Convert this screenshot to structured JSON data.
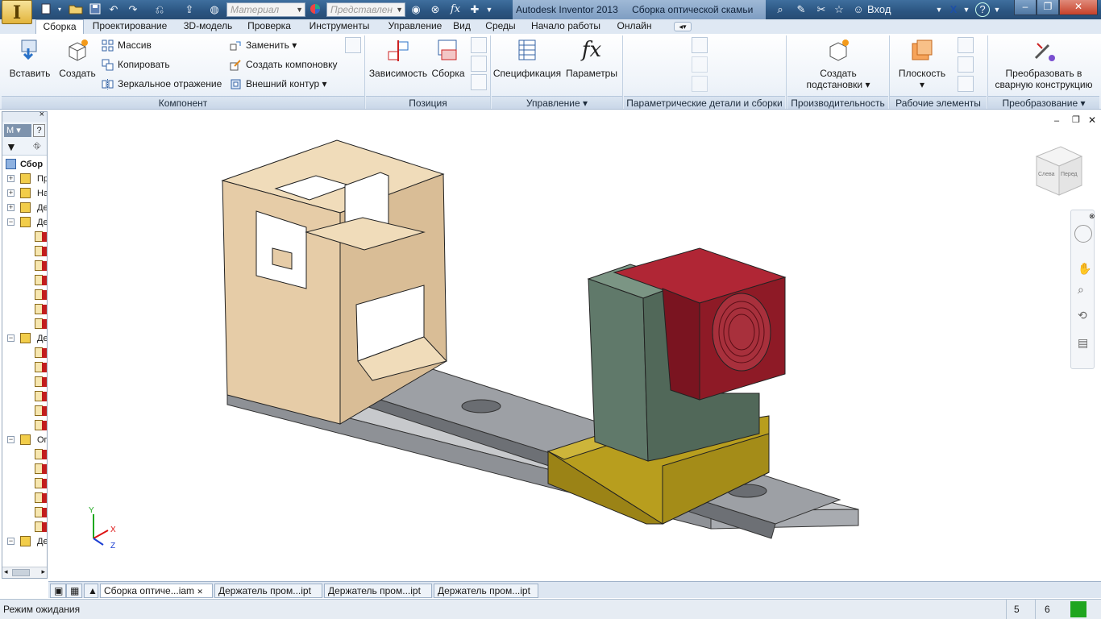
{
  "titlebar": {
    "app_logo": "I",
    "material_placeholder": "Материал",
    "appearance_placeholder": "Представлен",
    "fx": "fx",
    "app_name": "Autodesk Inventor 2013",
    "document_title": "Сборка оптической скамьи",
    "signin_label": "Вход"
  },
  "tabs": [
    "Сборка",
    "Проектирование",
    "3D-модель",
    "Проверка",
    "Инструменты",
    "Управление",
    "Вид",
    "Среды",
    "Начало работы",
    "Онлайн"
  ],
  "ribbon": {
    "component": {
      "insert": "Вставить",
      "create": "Создать",
      "pattern": "Массив",
      "copy": "Копировать",
      "mirror": "Зеркальное отражение",
      "replace": "Заменить",
      "make_layout": "Создать компоновку",
      "shrinkwrap": "Внешний контур",
      "label": "Компонент"
    },
    "position": {
      "constrain": "Зависимость",
      "assemble": "Сборка",
      "label": "Позиция"
    },
    "manage": {
      "bom": "Спецификация",
      "parameters": "Параметры",
      "label": "Управление"
    },
    "ipart_label": "Параметрические детали и сборки",
    "productivity": {
      "create_substitute_line1": "Создать",
      "create_substitute_line2": "подстановки",
      "label": "Производительность"
    },
    "work_features": {
      "plane": "Плоскость",
      "label": "Рабочие элементы"
    },
    "convert": {
      "weldment_line1": "Преобразовать в",
      "weldment_line2": "сварную конструкцию",
      "label": "Преобразование"
    }
  },
  "browser": {
    "mode_label": "М",
    "root": "Сбор",
    "rows": [
      {
        "label": "Пр",
        "indent": 1
      },
      {
        "label": "На",
        "indent": 1
      },
      {
        "label": "Де",
        "indent": 1
      },
      {
        "label": "Де",
        "indent": 1
      },
      {
        "label": "",
        "indent": 2
      },
      {
        "label": "",
        "indent": 2
      },
      {
        "label": "",
        "indent": 2
      },
      {
        "label": "",
        "indent": 2
      },
      {
        "label": "",
        "indent": 2
      },
      {
        "label": "",
        "indent": 2
      },
      {
        "label": "",
        "indent": 2
      },
      {
        "label": "Де",
        "indent": 1
      },
      {
        "label": "",
        "indent": 2
      },
      {
        "label": "",
        "indent": 2
      },
      {
        "label": "",
        "indent": 2
      },
      {
        "label": "",
        "indent": 2
      },
      {
        "label": "",
        "indent": 2
      },
      {
        "label": "",
        "indent": 2
      },
      {
        "label": "Ог",
        "indent": 1
      },
      {
        "label": "",
        "indent": 2
      },
      {
        "label": "",
        "indent": 2
      },
      {
        "label": "",
        "indent": 2
      },
      {
        "label": "",
        "indent": 2
      },
      {
        "label": "",
        "indent": 2
      },
      {
        "label": "",
        "indent": 2
      },
      {
        "label": "Де",
        "indent": 1
      }
    ]
  },
  "viewcube": {
    "left_face": "Слева",
    "front_face": "Перед"
  },
  "axes": {
    "y": "Y",
    "x": "X",
    "z": "Z"
  },
  "doc_tabs": [
    {
      "label": "Сборка оптиче...iam",
      "active": true
    },
    {
      "label": "Держатель пром...ipt",
      "active": false
    },
    {
      "label": "Держатель пром...ipt",
      "active": false
    },
    {
      "label": "Держатель пром...ipt",
      "active": false
    }
  ],
  "status": {
    "text": "Режим ожидания",
    "count1": "5",
    "count2": "6"
  },
  "colors": {
    "stand_body": "#e3c9a3",
    "rail": "#9b9ea3",
    "carriage": "#b49c1c",
    "bracket": "#5f7a6a",
    "lens_holder": "#8e1a26",
    "status_ok": "#1fa51f"
  }
}
